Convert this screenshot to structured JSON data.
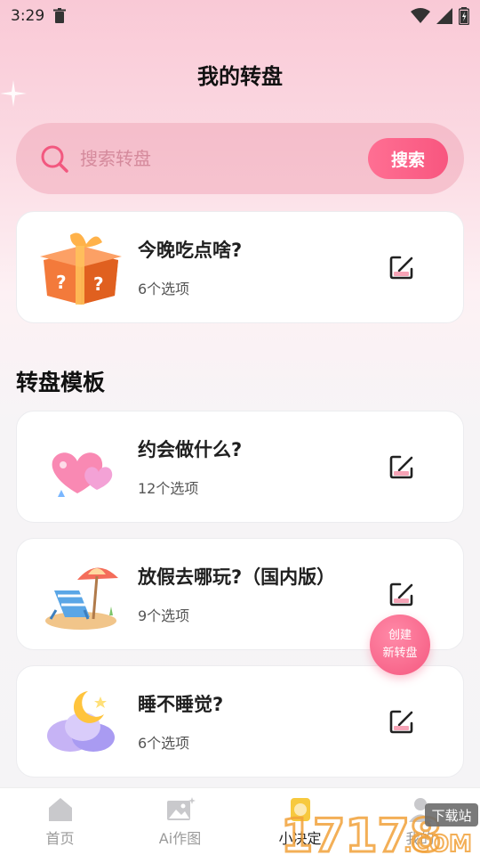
{
  "status_bar": {
    "time": "3:29"
  },
  "header": {
    "title": "我的转盘"
  },
  "search": {
    "placeholder": "搜索转盘",
    "button_label": "搜索"
  },
  "my_wheel": {
    "title": "今晚吃点啥?",
    "count": "6个选项",
    "thumb": "mystery-box-icon"
  },
  "templates": {
    "heading": "转盘模板",
    "items": [
      {
        "title": "约会做什么?",
        "count": "12个选项",
        "thumb": "hearts-balloon-icon"
      },
      {
        "title": "放假去哪玩?（国内版）",
        "count": "9个选项",
        "thumb": "beach-chair-icon"
      },
      {
        "title": "睡不睡觉?",
        "count": "6个选项",
        "thumb": "moon-cloud-icon"
      }
    ]
  },
  "fab": {
    "line1": "创建",
    "line2": "新转盘"
  },
  "bottom_nav": [
    {
      "label": "首页",
      "icon": "home-icon"
    },
    {
      "label": "Ai作图",
      "icon": "image-icon"
    },
    {
      "label": "小决定",
      "icon": "wheel-icon"
    },
    {
      "label": "我的",
      "icon": "profile-icon"
    }
  ],
  "watermark": {
    "text": "17178.COM",
    "tag": "下载站"
  },
  "colors": {
    "accent": "#f8567f",
    "search_bg": "#f2b2c1",
    "card_bg": "#ffffff"
  }
}
